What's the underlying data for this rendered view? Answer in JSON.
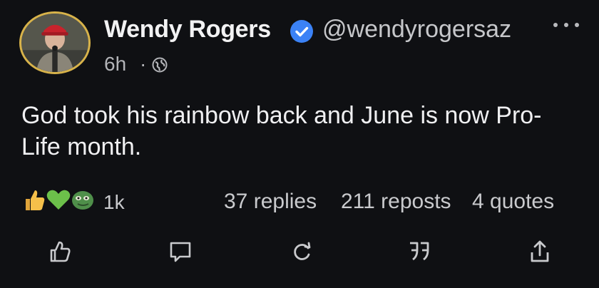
{
  "author": {
    "name": "Wendy Rogers",
    "handle": "@wendyrogersaz",
    "verified": true,
    "badge_color": "#3b82f6"
  },
  "post": {
    "time": "6h",
    "separator": "·",
    "visibility": "globe-icon",
    "text": "God took his rainbow back and June is now Pro-Life month."
  },
  "reactions": {
    "icons": [
      "thumbs-up-icon",
      "green-heart-icon",
      "green-face-icon"
    ],
    "count": "1k"
  },
  "stats": {
    "replies": "37 replies",
    "reposts": "211 reposts",
    "quotes": "4 quotes"
  },
  "actions": [
    "like-icon",
    "comment-icon",
    "repost-icon",
    "quote-icon",
    "share-icon"
  ]
}
